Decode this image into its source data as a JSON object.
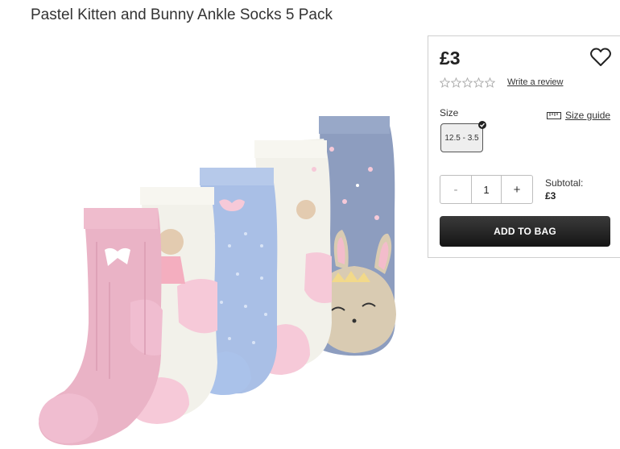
{
  "product": {
    "title": "Pastel Kitten and Bunny Ankle Socks 5 Pack"
  },
  "panel": {
    "price": "£3",
    "rating": {
      "stars": 0,
      "max": 5,
      "write_review": "Write a review"
    },
    "size": {
      "label": "Size",
      "guide": "Size guide",
      "selected": "12.5 - 3.5"
    },
    "quantity": {
      "minus": "-",
      "value": "1",
      "plus": "+"
    },
    "subtotal": {
      "label": "Subtotal:",
      "value": "£3"
    },
    "add_to_bag": "ADD TO BAG"
  },
  "icons": [
    "heart-icon",
    "star-icon",
    "ruler-icon",
    "check-icon"
  ],
  "colors": {
    "button_bg": "#1f1f1f",
    "button_text": "#ffffff",
    "border": "#cfcfcf"
  }
}
